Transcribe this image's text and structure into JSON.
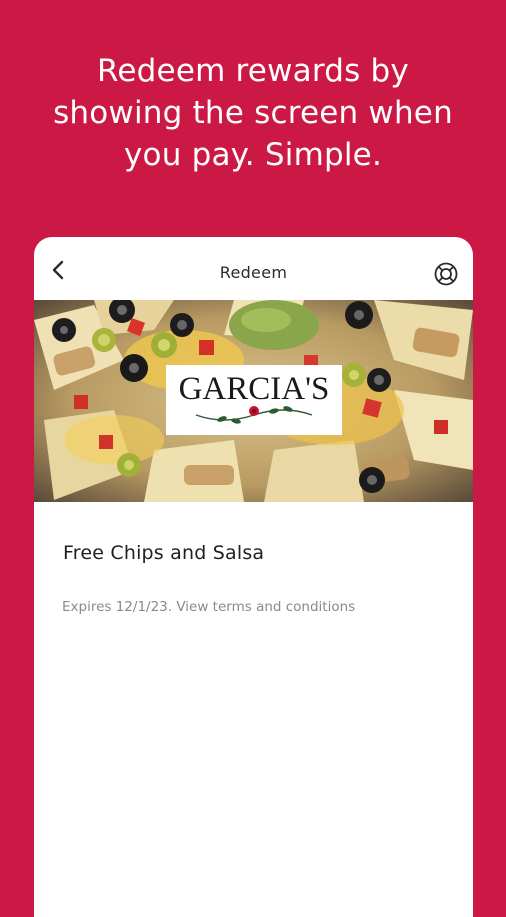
{
  "headline": {
    "line1": "Redeem rewards by",
    "line2": "showing the screen when",
    "line3": "you pay. Simple."
  },
  "topbar": {
    "title": "Redeem",
    "back_icon": "chevron-left-icon",
    "help_icon": "lifebuoy-icon"
  },
  "hero": {
    "logo_text": "GARCIA'S"
  },
  "reward": {
    "title": "Free Chips and Salsa",
    "expiry": "Expires 12/1/23. View terms and conditions"
  },
  "colors": {
    "background": "#cc1845",
    "card": "#ffffff",
    "accent_logo_rose": "#c8102e"
  }
}
